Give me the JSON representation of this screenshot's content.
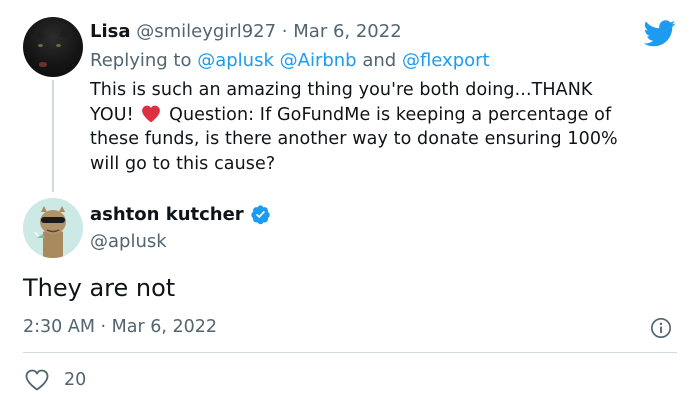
{
  "reply_tweet": {
    "name": "Lisa",
    "handle": "@smileygirl927",
    "separator": "·",
    "date": "Mar 6, 2022",
    "replying_prefix": "Replying to",
    "mentions": [
      "@aplusk",
      "@Airbnb",
      "@flexport"
    ],
    "mention_joiner": "and",
    "text_lines": [
      "This is such an amazing thing you're both doing...THANK",
      "YOU!",
      "Question: If GoFundMe is keeping a percentage of",
      "these funds, is there another way to donate ensuring 100%",
      "will go to this cause?"
    ],
    "emoji": "heart-emoji"
  },
  "main_tweet": {
    "name": "ashton kutcher",
    "handle": "@aplusk",
    "verified": true,
    "text": "They are not",
    "time": "2:30 AM",
    "separator": "·",
    "date": "Mar 6, 2022",
    "like_count": "20"
  },
  "colors": {
    "twitter_blue": "#1d9bf0",
    "text": "#0f1419",
    "muted": "#536471",
    "divider": "#cfd9de",
    "heart": "#dd2e44"
  },
  "icons": [
    "twitter-bird-icon",
    "verified-badge-icon",
    "info-icon",
    "heart-outline-icon"
  ]
}
